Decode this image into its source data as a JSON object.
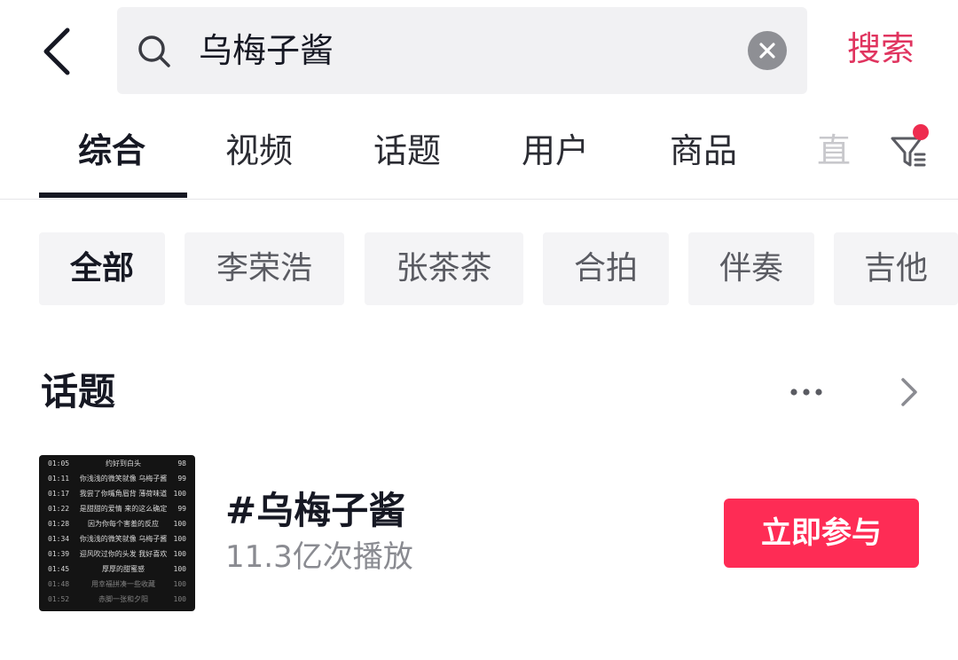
{
  "header": {
    "back_icon": "chevron-left-icon",
    "search_icon": "search-icon",
    "query": "乌梅子酱",
    "clear_icon": "close-circle-icon",
    "search_label": "搜索"
  },
  "tabs": [
    {
      "label": "综合",
      "active": true
    },
    {
      "label": "视频"
    },
    {
      "label": "话题"
    },
    {
      "label": "用户"
    },
    {
      "label": "商品"
    },
    {
      "label": "直"
    }
  ],
  "filter_icon": "filter-icon",
  "chips": [
    {
      "label": "全部",
      "active": true
    },
    {
      "label": "李荣浩"
    },
    {
      "label": "张茶茶"
    },
    {
      "label": "合拍"
    },
    {
      "label": "伴奏"
    },
    {
      "label": "吉他"
    }
  ],
  "section": {
    "title": "话题",
    "more_icon": "more-dots-icon",
    "arrow_icon": "chevron-right-icon"
  },
  "topic": {
    "name": "#乌梅子酱",
    "stats": "11.3亿次播放",
    "join_label": "立即参与",
    "thumbnail_rows": [
      {
        "time": "01:05",
        "lyric": "约好到白头",
        "score": "98"
      },
      {
        "time": "01:11",
        "lyric": "你浅浅的微笑就像 乌梅子酱",
        "score": "99"
      },
      {
        "time": "01:17",
        "lyric": "我尝了你嘴角眉背 薄荷味道",
        "score": "100"
      },
      {
        "time": "01:22",
        "lyric": "是甜甜的爱情 来的这么确定",
        "score": "99"
      },
      {
        "time": "01:28",
        "lyric": "因为你每个害羞的反应",
        "score": "100"
      },
      {
        "time": "01:34",
        "lyric": "你浅浅的微笑就像 乌梅子酱",
        "score": "100"
      },
      {
        "time": "01:39",
        "lyric": "迎风吹过你的头发 我好喜欢",
        "score": "100"
      },
      {
        "time": "01:45",
        "lyric": "厚厚的甜蜜感",
        "score": "100"
      },
      {
        "time": "01:48",
        "lyric": "用幸福拼凑一些收藏",
        "score": "100"
      },
      {
        "time": "01:52",
        "lyric": "赤脚一张和夕阳",
        "score": "100"
      }
    ]
  },
  "colors": {
    "accent": "#fe2c55",
    "search_text": "#e0345f"
  }
}
